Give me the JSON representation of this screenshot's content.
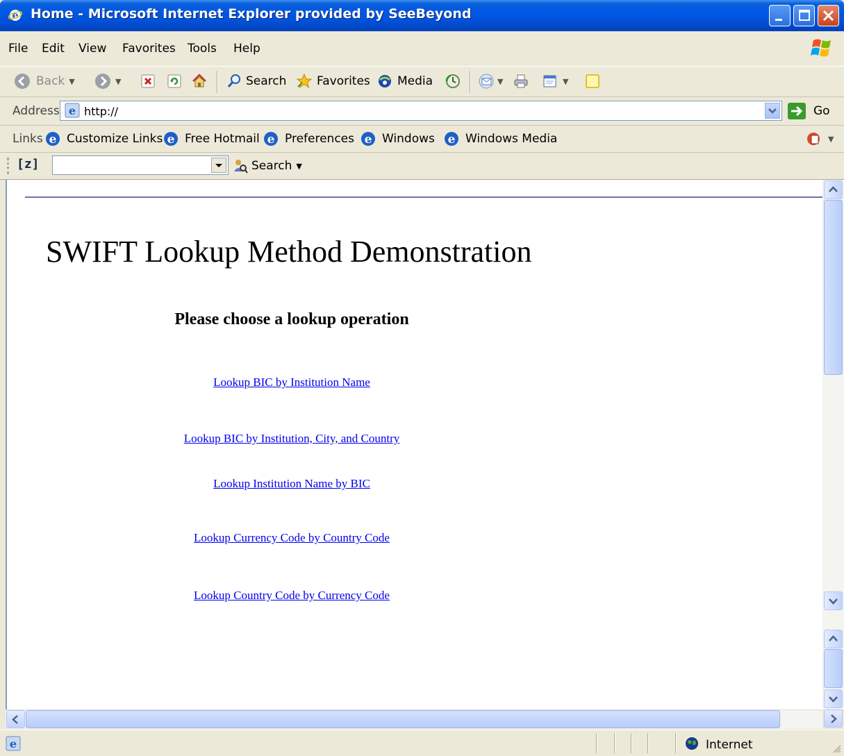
{
  "window": {
    "title": "Home - Microsoft Internet Explorer provided by SeeBeyond"
  },
  "menu": [
    "File",
    "Edit",
    "View",
    "Favorites",
    "Tools",
    "Help"
  ],
  "toolbar": {
    "back_label": "Back",
    "search_label": "Search",
    "favorites_label": "Favorites",
    "media_label": "Media"
  },
  "address": {
    "label": "Address",
    "value": "http://",
    "go_label": "Go"
  },
  "links": {
    "label": "Links",
    "items": [
      "Customize Links",
      "Free Hotmail",
      "Preferences",
      "Windows",
      "Windows Media"
    ]
  },
  "search_toolbar": {
    "search_label": "Search"
  },
  "page": {
    "title": "SWIFT Lookup Method Demonstration",
    "subtitle": "Please choose a lookup operation",
    "operations": [
      "Lookup BIC by Institution Name",
      "Lookup BIC by Institution, City, and Country",
      "Lookup Institution Name by BIC",
      "Lookup Currency Code by Country Code",
      "Lookup Country Code by Currency Code"
    ]
  },
  "status": {
    "zone": "Internet"
  },
  "colors": {
    "titlebar": "#0058e6",
    "link": "#0000ee",
    "chrome": "#ece9d8"
  }
}
